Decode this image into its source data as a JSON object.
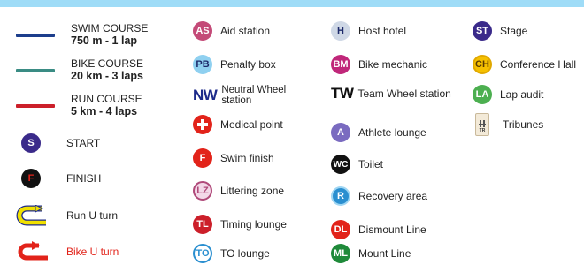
{
  "colors": {
    "background": "#9fdcf7",
    "swim": "#1d3e8c",
    "bike": "#3a8c84",
    "run": "#cc1f2a",
    "start": "#3a2a8a",
    "finish": "#111111",
    "u_turn_run": "#f0e000",
    "u_turn_bike": "#e2231a"
  },
  "courses": [
    {
      "name": "SWIM COURSE",
      "detail": "750 m - 1 lap"
    },
    {
      "name": "BIKE COURSE",
      "detail": "20 km - 3 laps"
    },
    {
      "name": "RUN COURSE",
      "detail": "5 km - 4 laps"
    }
  ],
  "col1": {
    "start": {
      "code": "S",
      "label": "START"
    },
    "finish": {
      "code": "F",
      "label": "FINISH"
    },
    "run_u_turn": {
      "icon": "u-turn-icon",
      "label": "Run U turn"
    },
    "bike_u_turn": {
      "icon": "u-turn-icon",
      "label": "Bike U turn"
    }
  },
  "col2": [
    {
      "code": "AS",
      "label": "Aid station"
    },
    {
      "code": "PB",
      "label": "Penalty box"
    },
    {
      "code": "NW",
      "label": "Neutral Wheel station"
    },
    {
      "icon": "medical-cross-icon",
      "label": "Medical point"
    },
    {
      "code": "F",
      "label": "Swim finish"
    },
    {
      "code": "LZ",
      "label": "Littering zone"
    },
    {
      "code": "TL",
      "label": "Timing lounge"
    },
    {
      "code": "TO",
      "label": "TO lounge"
    }
  ],
  "col3": [
    {
      "code": "H",
      "label": "Host hotel"
    },
    {
      "code": "BM",
      "label": "Bike mechanic"
    },
    {
      "code": "TW",
      "label": "Team Wheel station"
    },
    {
      "code": "A",
      "label": "Athlete lounge"
    },
    {
      "code": "WC",
      "label": "Toilet"
    },
    {
      "code": "R",
      "label": "Recovery area"
    },
    {
      "code": "DL",
      "label": "Dismount Line"
    },
    {
      "code": "ML",
      "label": "Mount Line"
    }
  ],
  "col4": [
    {
      "code": "ST",
      "label": "Stage"
    },
    {
      "code": "CH",
      "label": "Conference Hall"
    },
    {
      "code": "LA",
      "label": "Lap audit"
    },
    {
      "code": "TR",
      "label": "Tribunes"
    }
  ]
}
